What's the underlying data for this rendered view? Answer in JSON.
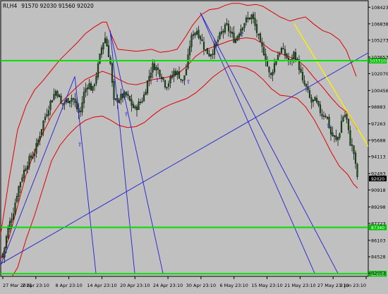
{
  "header": {
    "symbol": "RI,H4",
    "ohlc": "91570 92030 91560 92020"
  },
  "colors": {
    "background": "#c0c0c0",
    "candle": "#1a5c1a",
    "wick": "#000000",
    "bollinger": "#e00000",
    "hline": "#00e000",
    "trendline": "#2020d0",
    "yellow_line": "#ffee00",
    "price_tag_bg": "#000000",
    "price_tag_text": "#ffffff",
    "hline_tag_bg": "#00c000"
  },
  "chart_data": {
    "type": "candlestick",
    "title": "",
    "symbol": "RI",
    "timeframe": "H4",
    "y_ticks": [
      108423,
      106838,
      105273,
      103653,
      102070,
      100456,
      98883,
      97263,
      95688,
      94113,
      92493,
      90918,
      89298,
      87723,
      86103,
      84528,
      82953
    ],
    "ylim": [
      82650,
      109050
    ],
    "x_ticks": [
      "27 Mar 2015",
      "2 Apr 23:10",
      "8 Apr 23:10",
      "14 Apr 23:10",
      "20 Apr 23:10",
      "24 Apr 23:10",
      "30 Apr 23:10",
      "6 May 23:10",
      "15 May 23:10",
      "21 May 23:10",
      "27 May 23:10",
      "2 Jun 23:10"
    ],
    "current_price": "92020",
    "horizontal_levels": [
      {
        "value": 103310,
        "label": "103310"
      },
      {
        "value": 87340,
        "label": "87340"
      },
      {
        "value": 82900,
        "label": "82900"
      }
    ],
    "close_path": [
      [
        0,
        84800
      ],
      [
        3,
        84500
      ],
      [
        8,
        86400
      ],
      [
        12,
        87600
      ],
      [
        18,
        88900
      ],
      [
        24,
        90900
      ],
      [
        30,
        92200
      ],
      [
        36,
        93300
      ],
      [
        42,
        94000
      ],
      [
        48,
        94500
      ],
      [
        54,
        95900
      ],
      [
        60,
        97400
      ],
      [
        66,
        98500
      ],
      [
        72,
        99600
      ],
      [
        78,
        100400
      ],
      [
        82,
        100100
      ],
      [
        86,
        99000
      ],
      [
        90,
        99300
      ],
      [
        96,
        99600
      ],
      [
        102,
        99800
      ],
      [
        108,
        98700
      ],
      [
        112,
        98100
      ],
      [
        118,
        100200
      ],
      [
        124,
        101200
      ],
      [
        130,
        100400
      ],
      [
        136,
        102100
      ],
      [
        140,
        103500
      ],
      [
        144,
        104900
      ],
      [
        148,
        105500
      ],
      [
        152,
        104300
      ],
      [
        156,
        102800
      ],
      [
        160,
        99300
      ],
      [
        166,
        99600
      ],
      [
        172,
        99900
      ],
      [
        178,
        100000
      ],
      [
        184,
        99300
      ],
      [
        190,
        98600
      ],
      [
        196,
        99200
      ],
      [
        202,
        99700
      ],
      [
        208,
        101300
      ],
      [
        212,
        102200
      ],
      [
        216,
        102900
      ],
      [
        222,
        102500
      ],
      [
        228,
        101900
      ],
      [
        234,
        100900
      ],
      [
        240,
        101400
      ],
      [
        246,
        102300
      ],
      [
        252,
        102000
      ],
      [
        258,
        101300
      ],
      [
        264,
        102800
      ],
      [
        268,
        104800
      ],
      [
        272,
        105900
      ],
      [
        278,
        106200
      ],
      [
        284,
        105400
      ],
      [
        290,
        104300
      ],
      [
        296,
        103900
      ],
      [
        302,
        104400
      ],
      [
        308,
        105300
      ],
      [
        314,
        106100
      ],
      [
        320,
        106600
      ],
      [
        326,
        105900
      ],
      [
        332,
        105200
      ],
      [
        338,
        106100
      ],
      [
        344,
        106900
      ],
      [
        350,
        107300
      ],
      [
        356,
        107600
      ],
      [
        362,
        106300
      ],
      [
        368,
        104800
      ],
      [
        374,
        104000
      ],
      [
        378,
        102800
      ],
      [
        382,
        101600
      ],
      [
        386,
        102600
      ],
      [
        392,
        103800
      ],
      [
        398,
        104400
      ],
      [
        404,
        103800
      ],
      [
        410,
        103100
      ],
      [
        416,
        104100
      ],
      [
        420,
        103300
      ],
      [
        424,
        102500
      ],
      [
        428,
        101200
      ],
      [
        432,
        100900
      ],
      [
        436,
        100100
      ],
      [
        440,
        99300
      ],
      [
        446,
        99500
      ],
      [
        450,
        98800
      ],
      [
        456,
        98100
      ],
      [
        460,
        98300
      ],
      [
        464,
        97500
      ],
      [
        468,
        96300
      ],
      [
        472,
        96000
      ],
      [
        476,
        95600
      ],
      [
        480,
        96300
      ],
      [
        484,
        97900
      ],
      [
        488,
        98100
      ],
      [
        492,
        97300
      ],
      [
        494,
        95600
      ],
      [
        497,
        95300
      ],
      [
        500,
        94700
      ],
      [
        503,
        93200
      ],
      [
        506,
        92020
      ]
    ],
    "bollinger_upper": [
      [
        0,
        86700
      ],
      [
        12,
        92000
      ],
      [
        24,
        96700
      ],
      [
        36,
        99000
      ],
      [
        48,
        100500
      ],
      [
        60,
        101400
      ],
      [
        72,
        102400
      ],
      [
        84,
        103400
      ],
      [
        96,
        104200
      ],
      [
        108,
        105000
      ],
      [
        120,
        105900
      ],
      [
        132,
        106500
      ],
      [
        144,
        107000
      ],
      [
        150,
        107000
      ],
      [
        156,
        105900
      ],
      [
        166,
        104400
      ],
      [
        180,
        104300
      ],
      [
        192,
        104200
      ],
      [
        204,
        104300
      ],
      [
        214,
        104400
      ],
      [
        226,
        104100
      ],
      [
        238,
        104200
      ],
      [
        250,
        104400
      ],
      [
        262,
        105600
      ],
      [
        272,
        106700
      ],
      [
        284,
        107700
      ],
      [
        296,
        108200
      ],
      [
        308,
        108300
      ],
      [
        318,
        108600
      ],
      [
        328,
        108800
      ],
      [
        338,
        108800
      ],
      [
        350,
        108600
      ],
      [
        362,
        108700
      ],
      [
        372,
        108500
      ],
      [
        384,
        108000
      ],
      [
        396,
        107500
      ],
      [
        410,
        107100
      ],
      [
        420,
        107300
      ],
      [
        432,
        107500
      ],
      [
        444,
        106800
      ],
      [
        456,
        106200
      ],
      [
        468,
        105900
      ],
      [
        480,
        105300
      ],
      [
        490,
        104300
      ],
      [
        498,
        102900
      ],
      [
        504,
        101800
      ]
    ],
    "bollinger_middle": [
      [
        0,
        84300
      ],
      [
        12,
        86400
      ],
      [
        24,
        89400
      ],
      [
        36,
        92400
      ],
      [
        48,
        94600
      ],
      [
        60,
        96400
      ],
      [
        72,
        98000
      ],
      [
        84,
        99200
      ],
      [
        96,
        100000
      ],
      [
        108,
        100800
      ],
      [
        120,
        101500
      ],
      [
        132,
        101900
      ],
      [
        144,
        102300
      ],
      [
        156,
        102000
      ],
      [
        168,
        101500
      ],
      [
        180,
        101100
      ],
      [
        192,
        101000
      ],
      [
        204,
        101200
      ],
      [
        216,
        101500
      ],
      [
        228,
        101600
      ],
      [
        240,
        101800
      ],
      [
        252,
        102100
      ],
      [
        264,
        102800
      ],
      [
        276,
        103700
      ],
      [
        288,
        104300
      ],
      [
        300,
        104600
      ],
      [
        312,
        104900
      ],
      [
        324,
        105200
      ],
      [
        336,
        105400
      ],
      [
        348,
        105500
      ],
      [
        360,
        105400
      ],
      [
        372,
        104900
      ],
      [
        384,
        104300
      ],
      [
        396,
        104000
      ],
      [
        408,
        103700
      ],
      [
        420,
        103400
      ],
      [
        432,
        102700
      ],
      [
        444,
        101700
      ],
      [
        456,
        100800
      ],
      [
        468,
        99800
      ],
      [
        480,
        98900
      ],
      [
        492,
        98300
      ],
      [
        500,
        97400
      ],
      [
        506,
        96700
      ]
    ],
    "bollinger_lower": [
      [
        0,
        82100
      ],
      [
        12,
        82200
      ],
      [
        24,
        83500
      ],
      [
        36,
        86200
      ],
      [
        48,
        88500
      ],
      [
        60,
        91100
      ],
      [
        72,
        93700
      ],
      [
        84,
        95200
      ],
      [
        96,
        96200
      ],
      [
        108,
        97000
      ],
      [
        120,
        97600
      ],
      [
        132,
        97900
      ],
      [
        144,
        98000
      ],
      [
        156,
        97600
      ],
      [
        168,
        97100
      ],
      [
        180,
        96900
      ],
      [
        192,
        97000
      ],
      [
        204,
        97400
      ],
      [
        216,
        98100
      ],
      [
        228,
        98700
      ],
      [
        240,
        99100
      ],
      [
        252,
        99400
      ],
      [
        264,
        99700
      ],
      [
        276,
        100200
      ],
      [
        288,
        100900
      ],
      [
        300,
        101700
      ],
      [
        312,
        102300
      ],
      [
        324,
        102800
      ],
      [
        336,
        102800
      ],
      [
        348,
        102600
      ],
      [
        360,
        102200
      ],
      [
        372,
        101500
      ],
      [
        384,
        100600
      ],
      [
        396,
        100000
      ],
      [
        408,
        99900
      ],
      [
        420,
        99700
      ],
      [
        432,
        98900
      ],
      [
        444,
        97700
      ],
      [
        456,
        96200
      ],
      [
        468,
        94600
      ],
      [
        480,
        93200
      ],
      [
        492,
        92400
      ],
      [
        500,
        91500
      ],
      [
        506,
        91100
      ]
    ],
    "trendlines": [
      {
        "color": "blue",
        "from": [
          0,
          83850
        ],
        "to": [
          522,
          104100
        ]
      },
      {
        "color": "blue",
        "from": [
          0,
          83700
        ],
        "to": [
          105,
          101800
        ]
      },
      {
        "color": "blue",
        "from": [
          105,
          101800
        ],
        "to": [
          135,
          82950
        ]
      },
      {
        "color": "blue",
        "from": [
          155,
          106200
        ],
        "to": [
          190,
          82950
        ]
      },
      {
        "color": "blue",
        "from": [
          155,
          106200
        ],
        "to": [
          230,
          82950
        ]
      },
      {
        "color": "blue",
        "from": [
          283,
          107900
        ],
        "to": [
          445,
          82950
        ]
      },
      {
        "color": "blue",
        "from": [
          283,
          107900
        ],
        "to": [
          478,
          82950
        ]
      },
      {
        "color": "yellow",
        "from": [
          416,
          106850
        ],
        "to": [
          521,
          95100
        ]
      }
    ],
    "fractal_markers": [
      {
        "x": 112,
        "y": 95100
      },
      {
        "x": 178,
        "y": 98000
      },
      {
        "x": 222,
        "y": 101300
      },
      {
        "x": 266,
        "y": 101100
      },
      {
        "x": 342,
        "y": 105600
      },
      {
        "x": 464,
        "y": 96900
      }
    ]
  }
}
